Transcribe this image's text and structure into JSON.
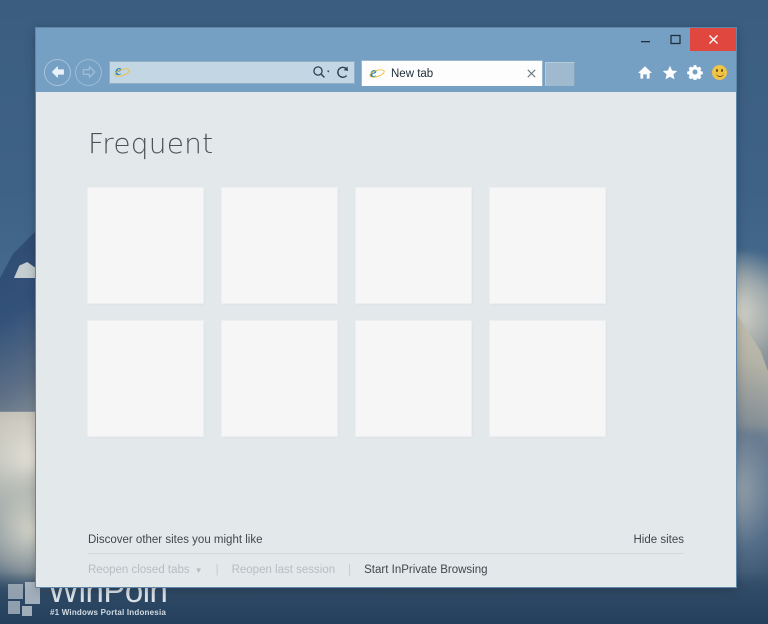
{
  "desktop": {
    "watermark": {
      "name": "WinPoin",
      "subtitle": "#1 Windows Portal Indonesia",
      "logo_icon": "winpoin-squares-logo-icon"
    },
    "wallpaper_colors": {
      "sky": "#3d6285",
      "mountain": "#33527a",
      "cloud": "#d8d7cb"
    }
  },
  "window": {
    "controls": {
      "minimize_label": "–",
      "minimize_icon": "minimize-icon",
      "maximize_label": "❐",
      "maximize_icon": "maximize-icon",
      "close_label": "×",
      "close_icon": "close-icon",
      "close_color": "#e0473f"
    },
    "chrome_color": "#75a0c4"
  },
  "toolbar": {
    "back_icon": "back-arrow-icon",
    "forward_icon": "forward-arrow-icon",
    "address": {
      "value": "",
      "placeholder": "",
      "site_icon": "internet-explorer-icon",
      "search_icon": "search-magnifier-icon",
      "search_dropdown_icon": "chevron-down-icon",
      "refresh_icon": "refresh-icon"
    },
    "icons": [
      {
        "name": "home-icon",
        "label": "Home"
      },
      {
        "name": "star-icon",
        "label": "Favorites"
      },
      {
        "name": "gear-icon",
        "label": "Tools"
      },
      {
        "name": "smiley-face-icon",
        "label": "Send feedback"
      }
    ],
    "new_tab_button_icon": "new-tab-button-icon"
  },
  "tabs": [
    {
      "title": "New tab",
      "favicon": "internet-explorer-icon",
      "close_label": "×",
      "close_icon": "close-icon",
      "active": true
    }
  ],
  "new_tab_page": {
    "heading": "Frequent",
    "tiles": [
      {
        "label": ""
      },
      {
        "label": ""
      },
      {
        "label": ""
      },
      {
        "label": ""
      },
      {
        "label": ""
      },
      {
        "label": ""
      },
      {
        "label": ""
      },
      {
        "label": ""
      }
    ],
    "footer": {
      "discover_text": "Discover other sites you might like",
      "hide_sites_label": "Hide sites",
      "session_links": [
        {
          "label": "Reopen closed tabs",
          "disabled": true,
          "has_caret": true
        },
        {
          "label": "Reopen last session",
          "disabled": true,
          "has_caret": false
        },
        {
          "label": "Start InPrivate Browsing",
          "disabled": false,
          "has_caret": false
        }
      ],
      "separator": "|",
      "caret": "▼"
    },
    "background_color": "#e3e8eb",
    "tile_color": "#f6f6f7"
  }
}
